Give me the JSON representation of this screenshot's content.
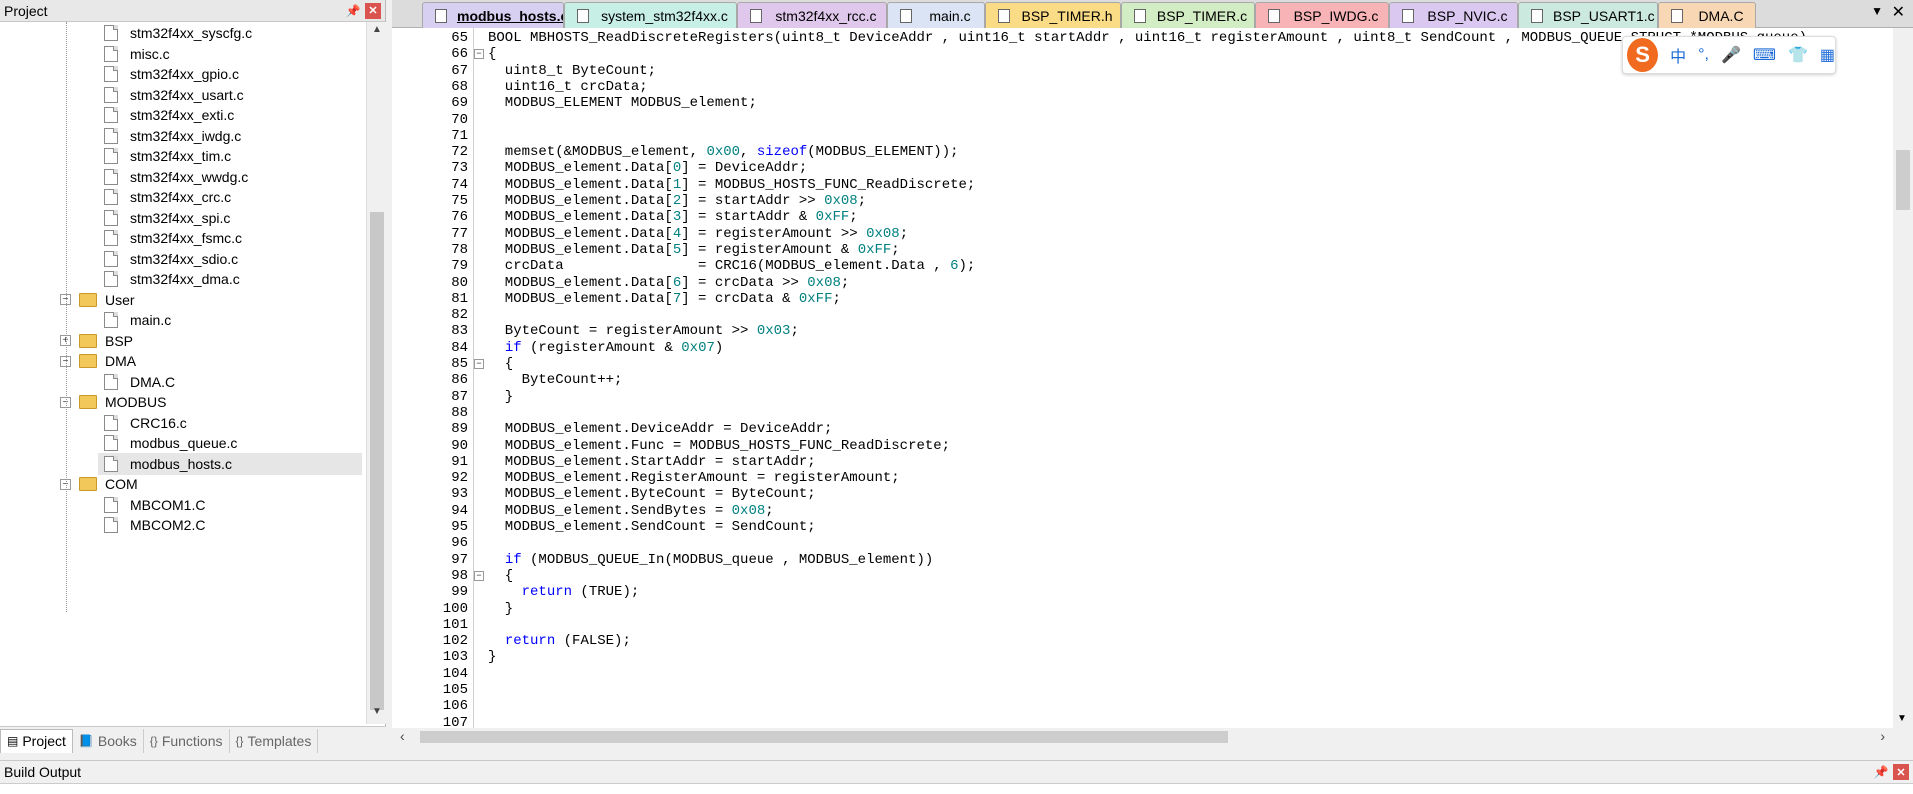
{
  "project_panel": {
    "title": "Project",
    "pin_icon": "pin-icon",
    "close_icon": "close-icon",
    "tree": [
      {
        "type": "file",
        "label": "stm32f4xx_syscfg.c",
        "indent": 2
      },
      {
        "type": "file",
        "label": "misc.c",
        "indent": 2
      },
      {
        "type": "file",
        "label": "stm32f4xx_gpio.c",
        "indent": 2
      },
      {
        "type": "file",
        "label": "stm32f4xx_usart.c",
        "indent": 2
      },
      {
        "type": "file",
        "label": "stm32f4xx_exti.c",
        "indent": 2
      },
      {
        "type": "file",
        "label": "stm32f4xx_iwdg.c",
        "indent": 2
      },
      {
        "type": "file",
        "label": "stm32f4xx_tim.c",
        "indent": 2
      },
      {
        "type": "file",
        "label": "stm32f4xx_wwdg.c",
        "indent": 2
      },
      {
        "type": "file",
        "label": "stm32f4xx_crc.c",
        "indent": 2
      },
      {
        "type": "file",
        "label": "stm32f4xx_spi.c",
        "indent": 2
      },
      {
        "type": "file",
        "label": "stm32f4xx_fsmc.c",
        "indent": 2
      },
      {
        "type": "file",
        "label": "stm32f4xx_sdio.c",
        "indent": 2
      },
      {
        "type": "file",
        "label": "stm32f4xx_dma.c",
        "indent": 2
      },
      {
        "type": "folder",
        "label": "User",
        "expanded": true,
        "indent": 1
      },
      {
        "type": "file",
        "label": "main.c",
        "indent": 2
      },
      {
        "type": "folder",
        "label": "BSP",
        "expanded": false,
        "indent": 1
      },
      {
        "type": "folder",
        "label": "DMA",
        "expanded": true,
        "indent": 1
      },
      {
        "type": "file",
        "label": "DMA.C",
        "indent": 2
      },
      {
        "type": "folder",
        "label": "MODBUS",
        "expanded": true,
        "indent": 1
      },
      {
        "type": "file",
        "label": "CRC16.c",
        "indent": 2
      },
      {
        "type": "file",
        "label": "modbus_queue.c",
        "indent": 2
      },
      {
        "type": "file",
        "label": "modbus_hosts.c",
        "indent": 2,
        "selected": true
      },
      {
        "type": "folder",
        "label": "COM",
        "expanded": true,
        "indent": 1
      },
      {
        "type": "file",
        "label": "MBCOM1.C",
        "indent": 2
      },
      {
        "type": "file",
        "label": "MBCOM2.C",
        "indent": 2
      }
    ],
    "bottom_tabs": [
      {
        "label": "Project",
        "icon": "project-icon",
        "active": true
      },
      {
        "label": "Books",
        "icon": "books-icon",
        "active": false
      },
      {
        "label": "Functions",
        "icon": "functions-icon",
        "active": false
      },
      {
        "label": "Templates",
        "icon": "templates-icon",
        "active": false
      }
    ]
  },
  "editor_tabs": [
    {
      "label": "modbus_hosts.c",
      "color": "#d8d0f0",
      "active": true
    },
    {
      "label": "system_stm32f4xx.c",
      "color": "#c8efe6",
      "active": false
    },
    {
      "label": "stm32f4xx_rcc.c",
      "color": "#e0c8ec",
      "active": false
    },
    {
      "label": "main.c",
      "color": "#dbe4f5",
      "active": false
    },
    {
      "label": "BSP_TIMER.h",
      "color": "#fbdc86",
      "active": false
    },
    {
      "label": "BSP_TIMER.c",
      "color": "#d2ecc4",
      "active": false
    },
    {
      "label": "BSP_IWDG.c",
      "color": "#f7b3b6",
      "active": false
    },
    {
      "label": "BSP_NVIC.c",
      "color": "#dac8f0",
      "active": false
    },
    {
      "label": "BSP_USART1.c",
      "color": "#cce9df",
      "active": false
    },
    {
      "label": "DMA.C",
      "color": "#f8d8b4",
      "active": false
    }
  ],
  "editor": {
    "lines": [
      {
        "n": "65",
        "fold": "",
        "code": "BOOL MBHOSTS_ReadDiscreteRegisters(uint8_t DeviceAddr , uint16_t startAddr , uint16_t registerAmount , uint8_t SendCount , MODBUS_QUEUE_STRUCT *MODBUS_queue)"
      },
      {
        "n": "66",
        "fold": "-",
        "code": "{"
      },
      {
        "n": "67",
        "fold": "",
        "code": "  uint8_t ByteCount;"
      },
      {
        "n": "68",
        "fold": "",
        "code": "  uint16_t crcData;"
      },
      {
        "n": "69",
        "fold": "",
        "code": "  MODBUS_ELEMENT MODBUS_element;"
      },
      {
        "n": "70",
        "fold": "",
        "code": ""
      },
      {
        "n": "71",
        "fold": "",
        "code": ""
      },
      {
        "n": "72",
        "fold": "",
        "code": "  memset(&MODBUS_element, 0x00, sizeof(MODBUS_ELEMENT));"
      },
      {
        "n": "73",
        "fold": "",
        "code": "  MODBUS_element.Data[0] = DeviceAddr;"
      },
      {
        "n": "74",
        "fold": "",
        "code": "  MODBUS_element.Data[1] = MODBUS_HOSTS_FUNC_ReadDiscrete;"
      },
      {
        "n": "75",
        "fold": "",
        "code": "  MODBUS_element.Data[2] = startAddr >> 0x08;"
      },
      {
        "n": "76",
        "fold": "",
        "code": "  MODBUS_element.Data[3] = startAddr & 0xFF;"
      },
      {
        "n": "77",
        "fold": "",
        "code": "  MODBUS_element.Data[4] = registerAmount >> 0x08;"
      },
      {
        "n": "78",
        "fold": "",
        "code": "  MODBUS_element.Data[5] = registerAmount & 0xFF;"
      },
      {
        "n": "79",
        "fold": "",
        "code": "  crcData                = CRC16(MODBUS_element.Data , 6);"
      },
      {
        "n": "80",
        "fold": "",
        "code": "  MODBUS_element.Data[6] = crcData >> 0x08;"
      },
      {
        "n": "81",
        "fold": "",
        "code": "  MODBUS_element.Data[7] = crcData & 0xFF;"
      },
      {
        "n": "82",
        "fold": "",
        "code": ""
      },
      {
        "n": "83",
        "fold": "",
        "code": "  ByteCount = registerAmount >> 0x03;"
      },
      {
        "n": "84",
        "fold": "",
        "code": "  if (registerAmount & 0x07)"
      },
      {
        "n": "85",
        "fold": "-",
        "code": "  {"
      },
      {
        "n": "86",
        "fold": "",
        "code": "    ByteCount++;"
      },
      {
        "n": "87",
        "fold": "",
        "code": "  }"
      },
      {
        "n": "88",
        "fold": "",
        "code": ""
      },
      {
        "n": "89",
        "fold": "",
        "code": "  MODBUS_element.DeviceAddr = DeviceAddr;"
      },
      {
        "n": "90",
        "fold": "",
        "code": "  MODBUS_element.Func = MODBUS_HOSTS_FUNC_ReadDiscrete;"
      },
      {
        "n": "91",
        "fold": "",
        "code": "  MODBUS_element.StartAddr = startAddr;"
      },
      {
        "n": "92",
        "fold": "",
        "code": "  MODBUS_element.RegisterAmount = registerAmount;"
      },
      {
        "n": "93",
        "fold": "",
        "code": "  MODBUS_element.ByteCount = ByteCount;"
      },
      {
        "n": "94",
        "fold": "",
        "code": "  MODBUS_element.SendBytes = 0x08;"
      },
      {
        "n": "95",
        "fold": "",
        "code": "  MODBUS_element.SendCount = SendCount;"
      },
      {
        "n": "96",
        "fold": "",
        "code": ""
      },
      {
        "n": "97",
        "fold": "",
        "code": "  if (MODBUS_QUEUE_In(MODBUS_queue , MODBUS_element))"
      },
      {
        "n": "98",
        "fold": "-",
        "code": "  {"
      },
      {
        "n": "99",
        "fold": "",
        "code": "    return (TRUE);"
      },
      {
        "n": "100",
        "fold": "",
        "code": "  }"
      },
      {
        "n": "101",
        "fold": "",
        "code": ""
      },
      {
        "n": "102",
        "fold": "",
        "code": "  return (FALSE);"
      },
      {
        "n": "103",
        "fold": "",
        "code": "}"
      },
      {
        "n": "104",
        "fold": "",
        "code": ""
      },
      {
        "n": "105",
        "fold": "",
        "code": ""
      },
      {
        "n": "106",
        "fold": "",
        "code": ""
      },
      {
        "n": "107",
        "fold": "",
        "code": ""
      }
    ]
  },
  "ime_toolbar": {
    "logo": "S",
    "items": [
      {
        "icon": "chinese-mode-icon",
        "glyph": "中"
      },
      {
        "icon": "punctuation-icon",
        "glyph": "°,"
      },
      {
        "icon": "microphone-icon",
        "glyph": "🎤"
      },
      {
        "icon": "keyboard-icon",
        "glyph": "⌨"
      },
      {
        "icon": "skin-icon",
        "glyph": "👕"
      },
      {
        "icon": "apps-grid-icon",
        "glyph": "▦"
      }
    ]
  },
  "build_output": {
    "title": "Build Output"
  }
}
